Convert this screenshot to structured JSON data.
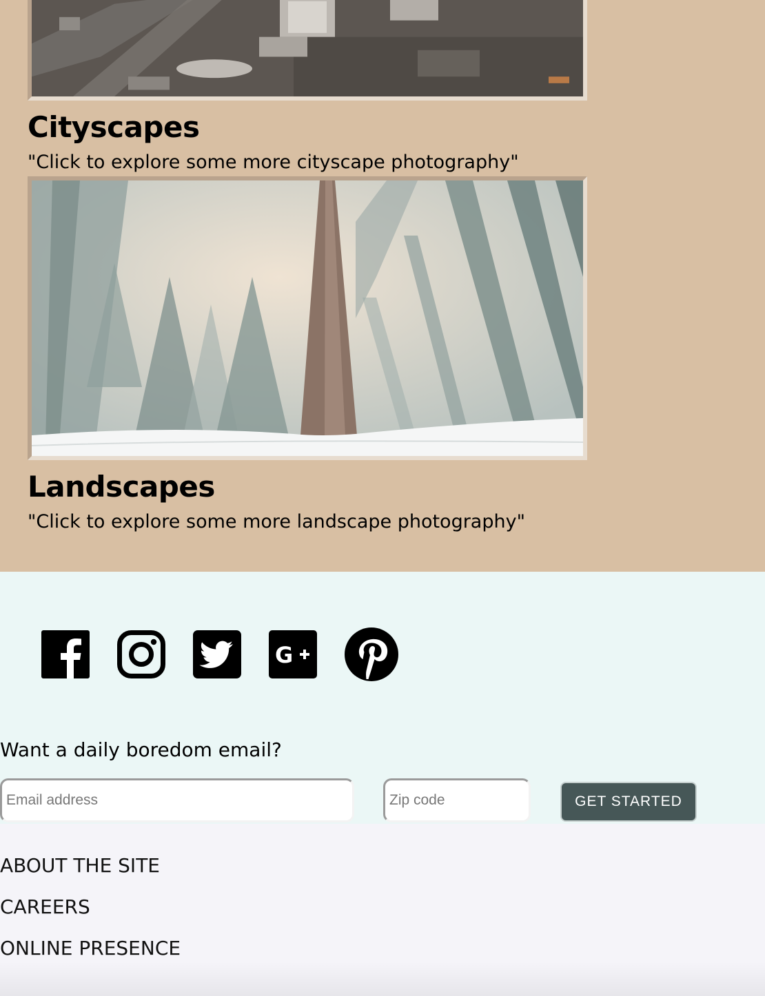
{
  "gallery": {
    "cityscapes": {
      "title": "Cityscapes",
      "description": "\"Click to explore some more cityscape photography\""
    },
    "landscapes": {
      "title": "Landscapes",
      "description": "\"Click to explore some more landscape photography\""
    }
  },
  "social": {
    "icons": [
      "facebook-icon",
      "instagram-icon",
      "twitter-icon",
      "google-plus-icon",
      "pinterest-icon"
    ]
  },
  "signup": {
    "question": "Want a daily boredom email?",
    "email_placeholder": "Email address",
    "zip_placeholder": "Zip code",
    "button_label": "GET STARTED"
  },
  "footer": {
    "links": [
      "ABOUT THE SITE",
      "CAREERS",
      "ONLINE PRESENCE"
    ]
  },
  "colors": {
    "gallery_bg": "#d8bfa3",
    "social_bg": "#ebf7f6",
    "footer_bg": "#f5f4f9",
    "button_bg": "#465757"
  }
}
